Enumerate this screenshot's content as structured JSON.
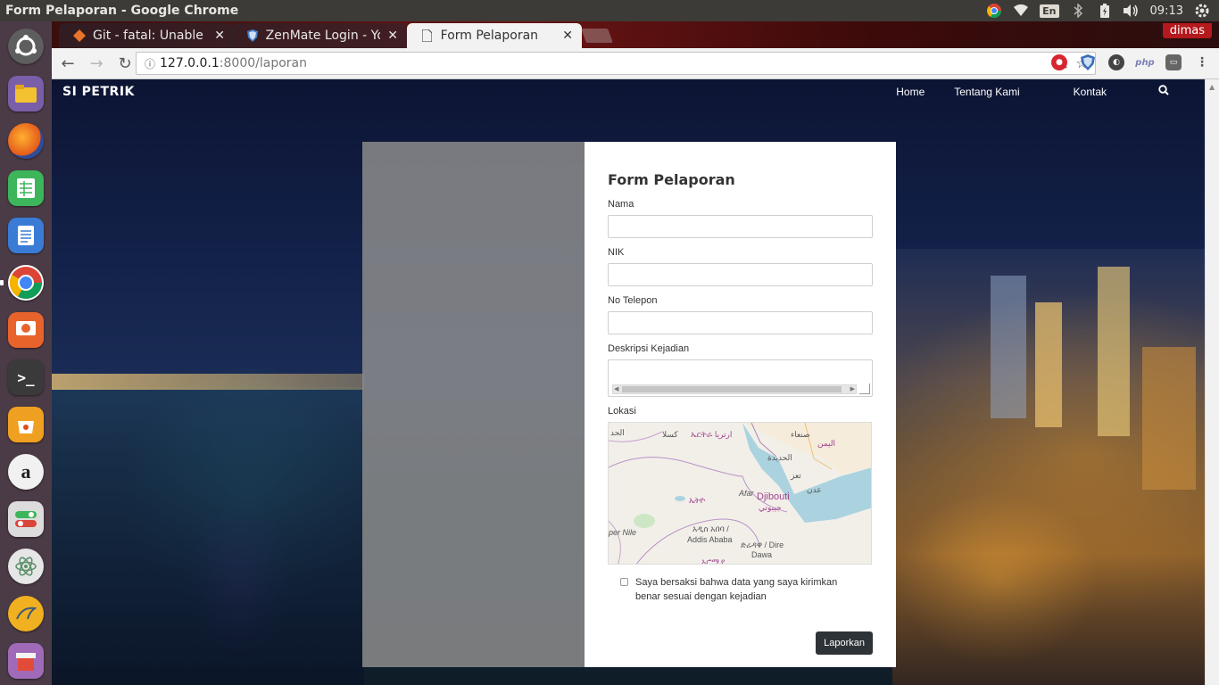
{
  "window": {
    "title": "Form Pelaporan - Google Chrome"
  },
  "tray": {
    "lang": "En",
    "time": "09:13"
  },
  "tabs": [
    {
      "label": "Git - fatal: Unable to",
      "favicon": "git-icon"
    },
    {
      "label": "ZenMate Login - Yo",
      "favicon": "zenmate-shield-icon"
    },
    {
      "label": "Form Pelaporan",
      "favicon": "document-icon"
    }
  ],
  "profile": "dimas",
  "address": {
    "host": "127.0.0.1",
    "path": ":8000/laporan"
  },
  "site": {
    "brand": "SI PETRIK",
    "nav": [
      "Home",
      "Tentang Kami",
      "Kontak"
    ]
  },
  "form": {
    "title": "Form Pelaporan",
    "fields": {
      "nama": "Nama",
      "nik": "NIK",
      "telepon": "No Telepon",
      "deskripsi": "Deskripsi Kejadian",
      "lokasi": "Lokasi"
    },
    "consent": "Saya bersaksi bahwa data yang saya kirimkan benar sesuai dengan kejadian",
    "submit": "Laporkan"
  },
  "map": {
    "labels": [
      "الحد",
      "كسلا",
      "ኤርትራ ارتريا",
      "صنعاء",
      "اليمن",
      "الحديدة",
      "تعز",
      "عدن",
      "Afar",
      "Djibouti",
      "جيبوتي",
      "ኤትዮ",
      "per Nile",
      "አዲስ አበባ /",
      "Addis Ababa",
      "ድሬዳዋ / Dire",
      "Dawa",
      "ኦሮሚያ"
    ]
  }
}
